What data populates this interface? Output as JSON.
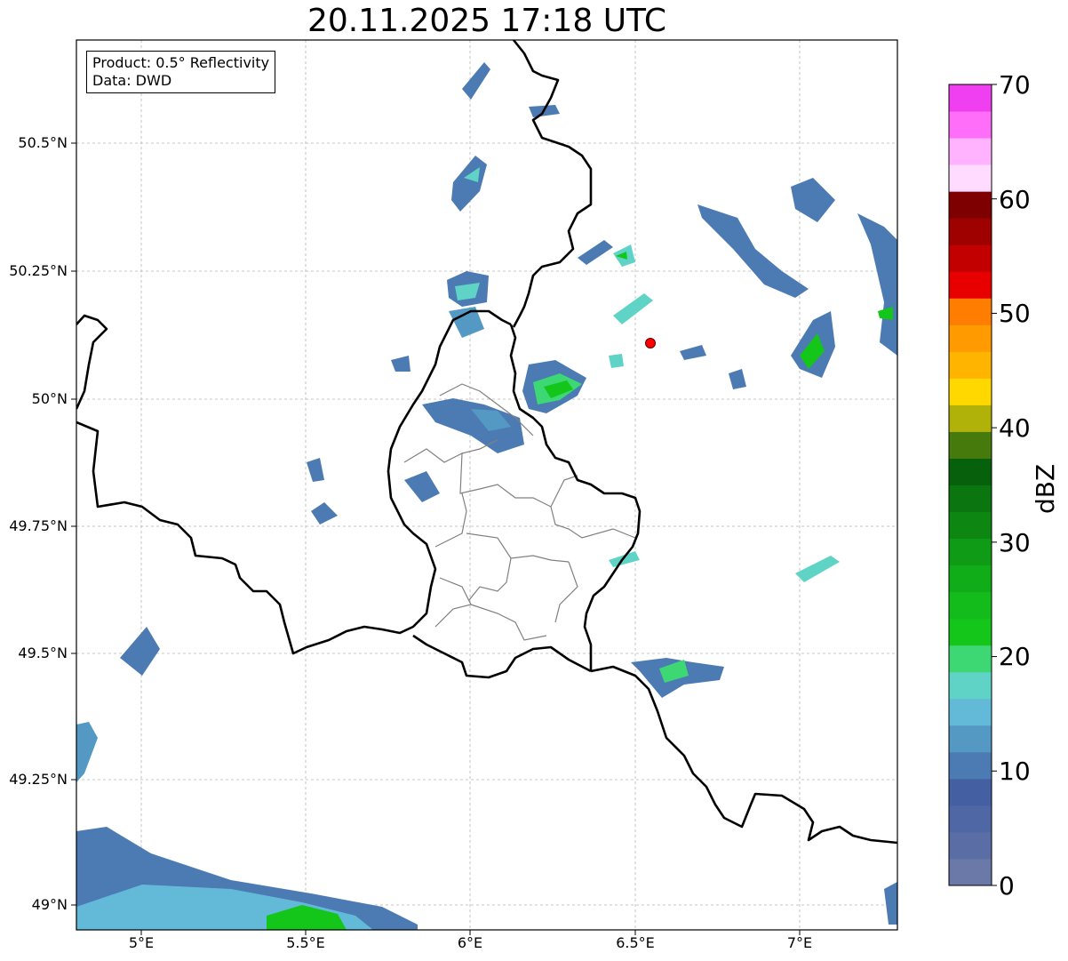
{
  "title": "20.11.2025 17:18 UTC",
  "info": {
    "product": "Product: 0.5° Reflectivity",
    "source": "Data: DWD"
  },
  "lat_labels": [
    "50.5°N",
    "50.25°N",
    "50°N",
    "49.75°N",
    "49.5°N",
    "49.25°N",
    "49°N"
  ],
  "lon_labels": [
    "5°E",
    "5.5°E",
    "6°E",
    "6.5°E",
    "7°E"
  ],
  "colorbar": {
    "unit": "dBZ",
    "ticks": [
      "0",
      "10",
      "20",
      "30",
      "40",
      "50",
      "60",
      "70"
    ],
    "colors": [
      "#6a79a8",
      "#5a6ea5",
      "#4f68a5",
      "#455fa3",
      "#4c7bb3",
      "#5399c4",
      "#63bad8",
      "#5fd3c5",
      "#3dd874",
      "#14c51a",
      "#13bb1b",
      "#11ad18",
      "#0f9b15",
      "#0d8712",
      "#0b7510",
      "#07600c",
      "#467a0c",
      "#b0b209",
      "#ffd800",
      "#ffb400",
      "#ff9a00",
      "#ff7d00",
      "#e80000",
      "#c20000",
      "#9f0000",
      "#7e0000",
      "#ffdcff",
      "#ffb3ff",
      "#ff6ef8",
      "#ef3ff0"
    ]
  },
  "marker_color": "#ff0000"
}
